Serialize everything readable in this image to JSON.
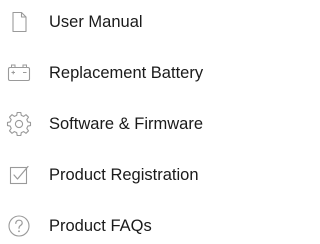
{
  "menu": {
    "items": [
      {
        "label": "User Manual",
        "icon": "document-icon"
      },
      {
        "label": "Replacement Battery",
        "icon": "battery-icon"
      },
      {
        "label": "Software & Firmware",
        "icon": "gear-icon"
      },
      {
        "label": "Product Registration",
        "icon": "checkbox-icon"
      },
      {
        "label": "Product FAQs",
        "icon": "question-icon"
      }
    ]
  },
  "colors": {
    "text": "#1a1a1a",
    "icon": "#9a9a9a"
  }
}
